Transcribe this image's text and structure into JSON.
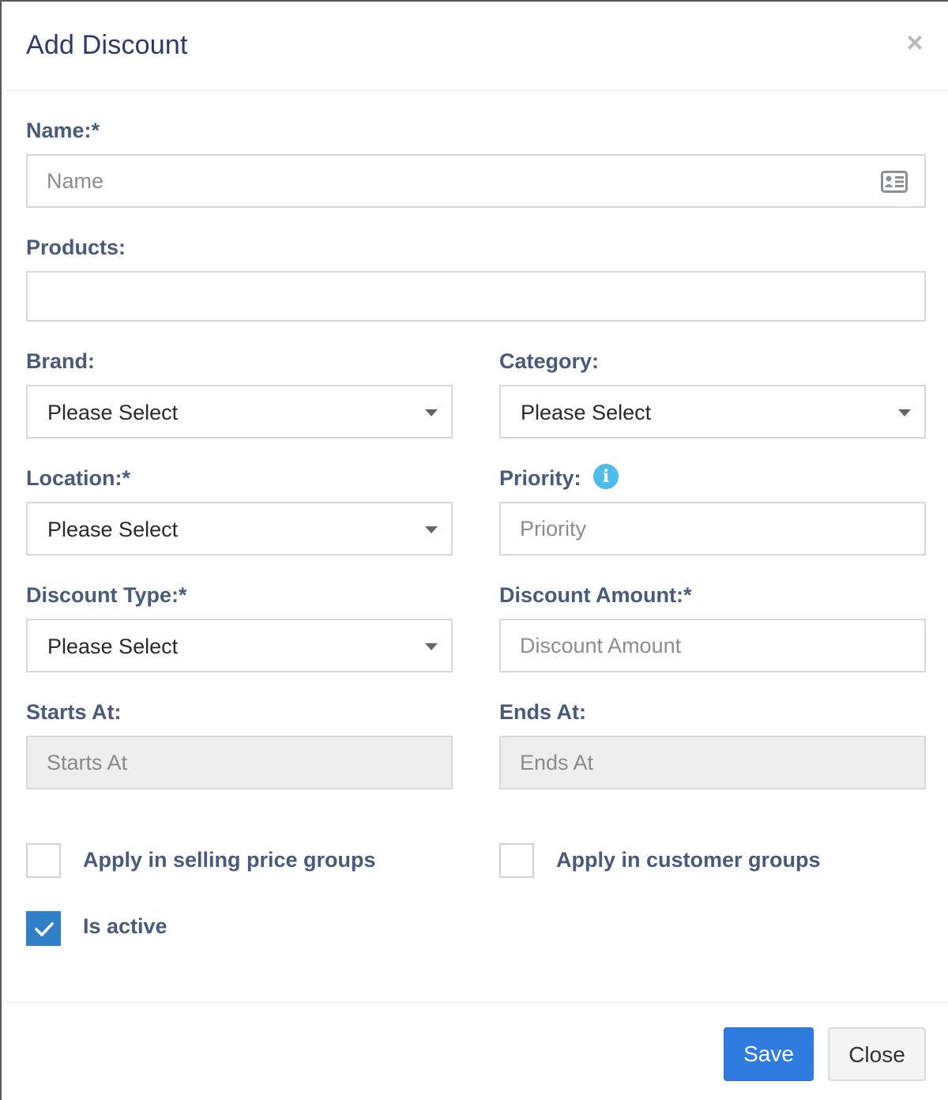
{
  "modal": {
    "title": "Add Discount",
    "close_symbol": "×"
  },
  "fields": {
    "name": {
      "label": "Name:*",
      "placeholder": "Name",
      "addon_icon": "id-card-icon"
    },
    "products": {
      "label": "Products:",
      "value": ""
    },
    "brand": {
      "label": "Brand:",
      "selected": "Please Select"
    },
    "category": {
      "label": "Category:",
      "selected": "Please Select"
    },
    "location": {
      "label": "Location:*",
      "selected": "Please Select"
    },
    "priority": {
      "label": "Priority:",
      "placeholder": "Priority",
      "info_symbol": "i"
    },
    "discount_type": {
      "label": "Discount Type:*",
      "selected": "Please Select"
    },
    "discount_amount": {
      "label": "Discount Amount:*",
      "placeholder": "Discount Amount"
    },
    "starts_at": {
      "label": "Starts At:",
      "placeholder": "Starts At"
    },
    "ends_at": {
      "label": "Ends At:",
      "placeholder": "Ends At"
    }
  },
  "checkboxes": {
    "selling_price_groups": {
      "label": "Apply in selling price groups",
      "checked": false
    },
    "customer_groups": {
      "label": "Apply in customer groups",
      "checked": false
    },
    "is_active": {
      "label": "Is active",
      "checked": true
    }
  },
  "footer": {
    "save_label": "Save",
    "close_label": "Close"
  },
  "colors": {
    "primary": "#2f7be0",
    "checkbox_checked": "#2f80c9",
    "info": "#4cbde8",
    "label": "#4a5a7a",
    "title": "#2f3a6b"
  }
}
